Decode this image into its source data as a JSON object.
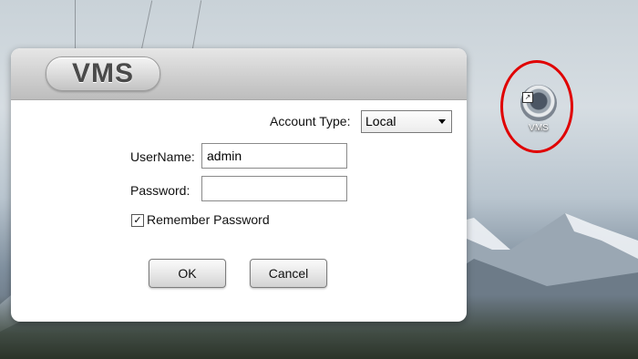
{
  "dialog": {
    "logo_text": "VMS",
    "account_type_label": "Account Type:",
    "account_type_value": "Local",
    "username_label": "UserName:",
    "username_value": "admin",
    "password_label": "Password:",
    "password_value": "",
    "remember_checked": true,
    "remember_label": "Remember Password",
    "ok_label": "OK",
    "cancel_label": "Cancel"
  },
  "desktop": {
    "icon_label": "VMS",
    "icon_name": "vms-app-icon"
  },
  "annotations": {
    "highlight_color": "#e00000",
    "arrow_color": "#e01010"
  }
}
